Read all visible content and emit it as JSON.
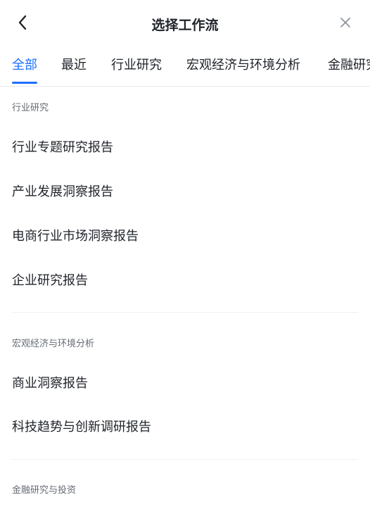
{
  "header": {
    "title": "选择工作流"
  },
  "icons": {
    "back": "chevron-left-icon",
    "close": "close-icon"
  },
  "colors": {
    "accent": "#1e6fff",
    "text": "#1f2329",
    "muted": "#646a73"
  },
  "tabs": [
    {
      "label": "全部",
      "active": true
    },
    {
      "label": "最近",
      "active": false
    },
    {
      "label": "行业研究",
      "active": false
    },
    {
      "label": "宏观经济与环境分析",
      "active": false
    },
    {
      "label": "金融研究",
      "active": false
    }
  ],
  "sections": [
    {
      "title": "行业研究",
      "items": [
        "行业专题研究报告",
        "产业发展洞察报告",
        "电商行业市场洞察报告",
        "企业研究报告"
      ]
    },
    {
      "title": "宏观经济与环境分析",
      "items": [
        "商业洞察报告",
        "科技趋势与创新调研报告"
      ]
    },
    {
      "title": "金融研究与投资",
      "items": []
    }
  ]
}
